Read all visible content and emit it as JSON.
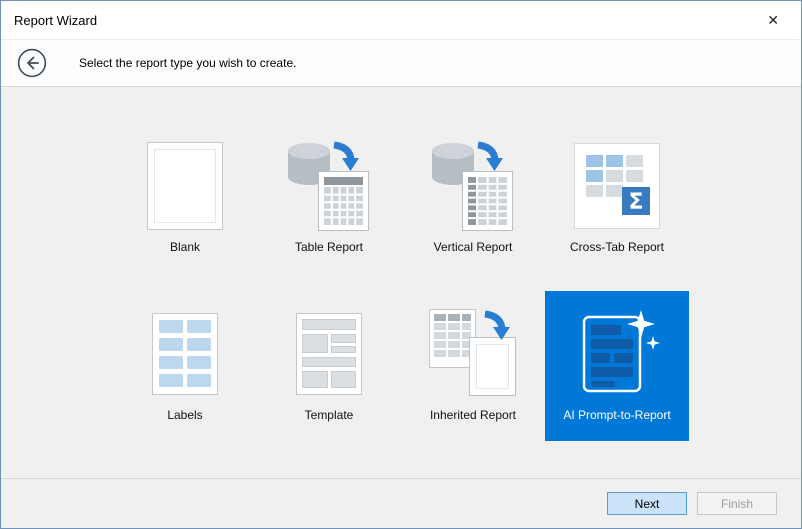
{
  "window": {
    "title": "Report Wizard",
    "close_glyph": "✕"
  },
  "header": {
    "instruction": "Select the report type you wish to create."
  },
  "report_types": [
    {
      "id": "blank",
      "label": "Blank",
      "selected": false
    },
    {
      "id": "table-report",
      "label": "Table Report",
      "selected": false
    },
    {
      "id": "vertical-report",
      "label": "Vertical Report",
      "selected": false
    },
    {
      "id": "cross-tab-report",
      "label": "Cross-Tab Report",
      "selected": false
    },
    {
      "id": "labels",
      "label": "Labels",
      "selected": false
    },
    {
      "id": "template",
      "label": "Template",
      "selected": false
    },
    {
      "id": "inherited-report",
      "label": "Inherited Report",
      "selected": false
    },
    {
      "id": "ai-prompt-to-report",
      "label": "AI Prompt-to-Report",
      "selected": true
    }
  ],
  "icons": {
    "sigma_glyph": "Σ"
  },
  "footer": {
    "next_label": "Next",
    "finish_label": "Finish",
    "finish_enabled": false
  },
  "colors": {
    "accent": "#0078d7",
    "selected_tile_background": "#0078d7",
    "arrow_blue": "#2b7cd3",
    "dialog_border": "#6e93b6"
  }
}
